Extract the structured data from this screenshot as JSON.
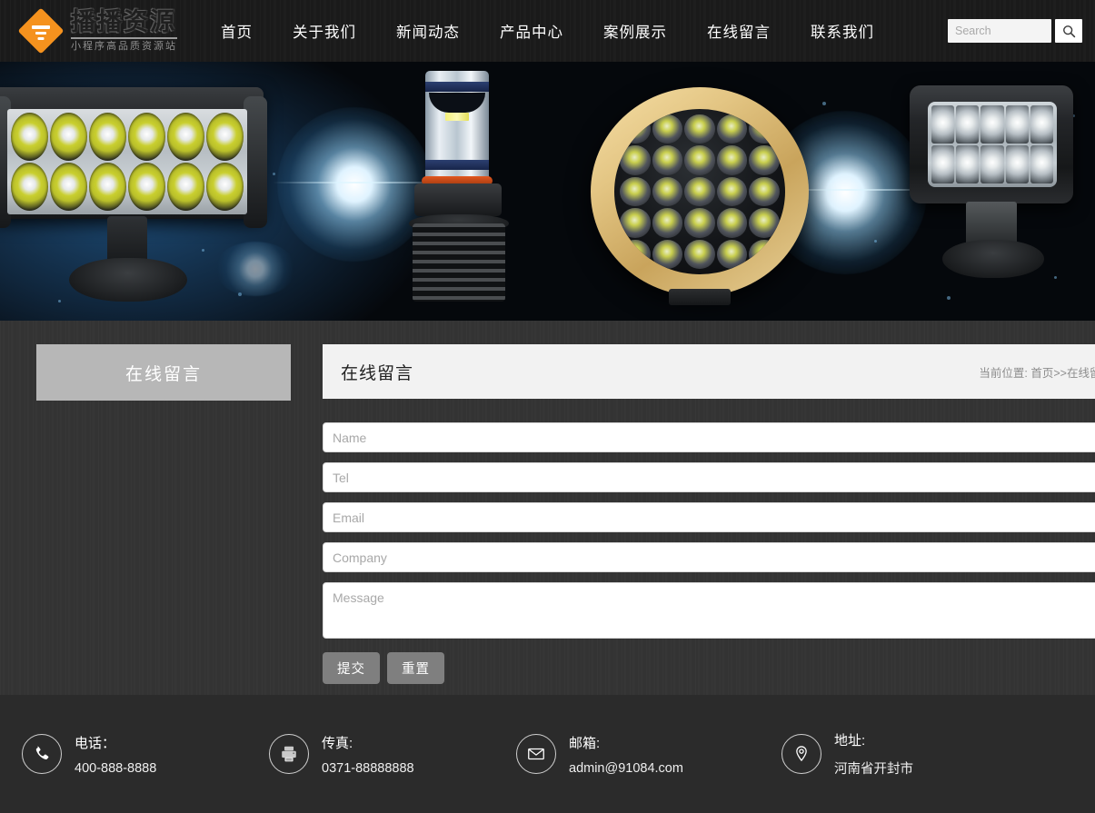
{
  "header": {
    "logo": {
      "title": "播播资源",
      "subtitle": "小程序高品质资源站",
      "icon": "diamond-logo-icon"
    },
    "nav": [
      {
        "label": "首页"
      },
      {
        "label": "关于我们"
      },
      {
        "label": "新闻动态"
      },
      {
        "label": "产品中心"
      },
      {
        "label": "案例展示"
      },
      {
        "label": "在线留言"
      },
      {
        "label": "联系我们"
      }
    ],
    "search": {
      "placeholder": "Search",
      "value": "",
      "button_icon": "search-icon"
    }
  },
  "banner": {
    "alt": "LED 车灯产品展示横幅"
  },
  "sidebar": {
    "heading": "在线留言"
  },
  "content": {
    "title": "在线留言",
    "breadcrumb_prefix": "当前位置:",
    "breadcrumb_home": "首页",
    "breadcrumb_sep": ">>",
    "breadcrumb_current": "在线留言"
  },
  "form": {
    "fields": [
      {
        "name": "name",
        "placeholder": "Name",
        "value": ""
      },
      {
        "name": "tel",
        "placeholder": "Tel",
        "value": ""
      },
      {
        "name": "email",
        "placeholder": "Email",
        "value": ""
      },
      {
        "name": "company",
        "placeholder": "Company",
        "value": ""
      }
    ],
    "message": {
      "placeholder": "Message",
      "value": ""
    },
    "submit_label": "提交",
    "reset_label": "重置"
  },
  "footer": {
    "items": [
      {
        "icon": "phone-icon",
        "label": "电话：",
        "value": "400-888-8888"
      },
      {
        "icon": "fax-icon",
        "label": "传真:",
        "value": "0371-88888888"
      },
      {
        "icon": "envelope-icon",
        "label": "邮箱:",
        "value": "admin@91084.com"
      },
      {
        "icon": "location-pin-icon",
        "label": "地址:",
        "value": "河南省开封市"
      }
    ]
  },
  "colors": {
    "header_bg": "#1b1b1b",
    "body_bg": "#343434",
    "footer_bg": "#2b2b2b",
    "accent_orange": "#f5921e",
    "panel_head_bg": "#f2f2f2",
    "sidebar_head_bg": "#b7b7b7",
    "button_bg": "#7f7f7f"
  }
}
